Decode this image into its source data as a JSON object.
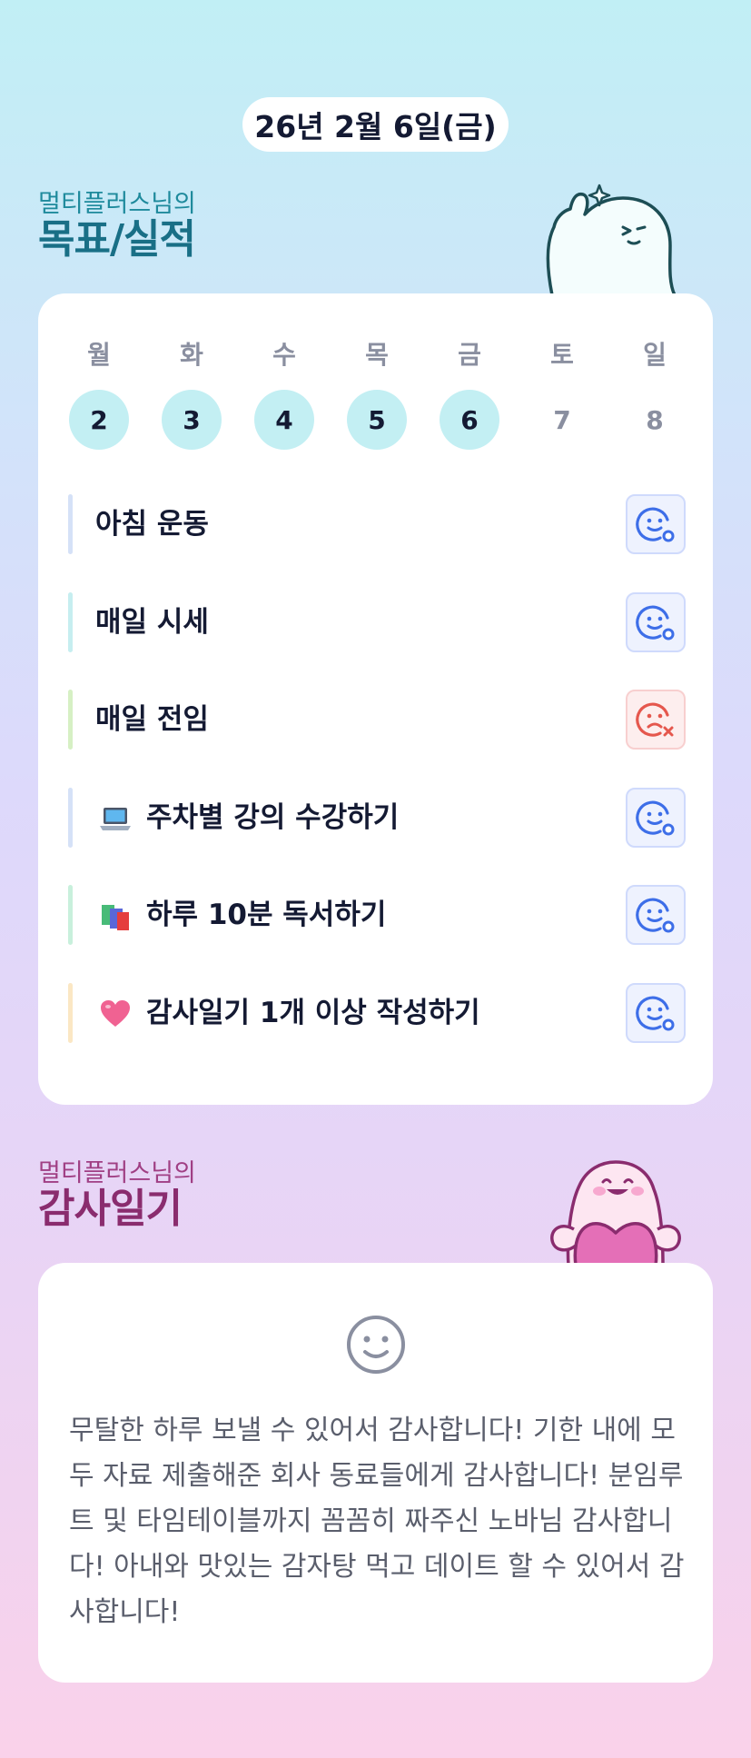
{
  "date_label": "26년 2월 6일(금)",
  "goals_section": {
    "subtitle": "멀티플러스님의",
    "title": "목표/실적"
  },
  "week": [
    {
      "name": "월",
      "num": "2",
      "done": true
    },
    {
      "name": "화",
      "num": "3",
      "done": true
    },
    {
      "name": "수",
      "num": "4",
      "done": true
    },
    {
      "name": "목",
      "num": "5",
      "done": true
    },
    {
      "name": "금",
      "num": "6",
      "done": true
    },
    {
      "name": "토",
      "num": "7",
      "done": false
    },
    {
      "name": "일",
      "num": "8",
      "done": false
    }
  ],
  "goals": [
    {
      "label": "아침 운동",
      "emoji": "",
      "status": "success",
      "bar_color": "#d5e1f7"
    },
    {
      "label": "매일 시세",
      "emoji": "",
      "status": "success",
      "bar_color": "#c6eef0"
    },
    {
      "label": "매일 전임",
      "emoji": "",
      "status": "fail",
      "bar_color": "#d6f0c4"
    },
    {
      "label": "주차별 강의 수강하기",
      "emoji": "laptop-icon",
      "status": "success",
      "bar_color": "#d5e1f7"
    },
    {
      "label": "하루 10분 독서하기",
      "emoji": "books-icon",
      "status": "success",
      "bar_color": "#c8f0dc"
    },
    {
      "label": "감사일기 1개 이상 작성하기",
      "emoji": "heart-icon",
      "status": "success",
      "bar_color": "#fbe7c4"
    }
  ],
  "diary_section": {
    "subtitle": "멀티플러스님의",
    "title": "감사일기"
  },
  "diary": {
    "mood_icon": "smile-icon",
    "text": "무탈한 하루 보낼 수 있어서 감사합니다! 기한 내에 모두 자료 제출해준 회사 동료들에게 감사합니다! 분임루트 및 타임테이블까지 꼼꼼히 짜주신 노바님 감사합니다! 아내와 맛있는 감자탕 먹고 데이트 할 수 있어서 감사합니다!"
  },
  "colors": {
    "success": "#3d6ee8",
    "fail": "#e5574d",
    "done_day": "#c3eff3"
  }
}
